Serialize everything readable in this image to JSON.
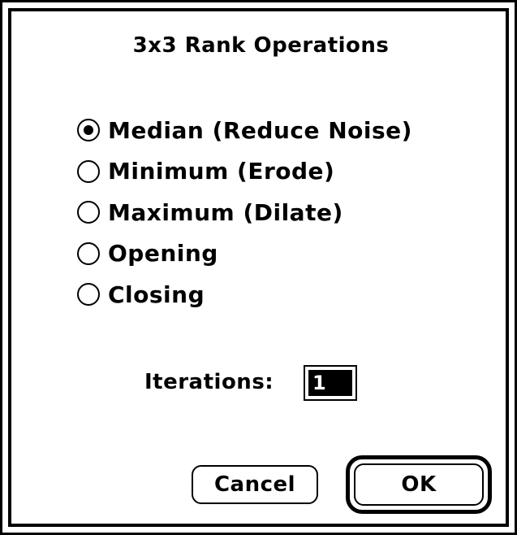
{
  "dialog": {
    "title": "3x3 Rank Operations",
    "options": [
      {
        "label": "Median (Reduce Noise)",
        "selected": true
      },
      {
        "label": "Minimum (Erode)",
        "selected": false
      },
      {
        "label": "Maximum (Dilate)",
        "selected": false
      },
      {
        "label": "Opening",
        "selected": false
      },
      {
        "label": "Closing",
        "selected": false
      }
    ],
    "iterations_label": "Iterations:",
    "iterations_value": "1",
    "cancel_label": "Cancel",
    "ok_label": "OK"
  }
}
